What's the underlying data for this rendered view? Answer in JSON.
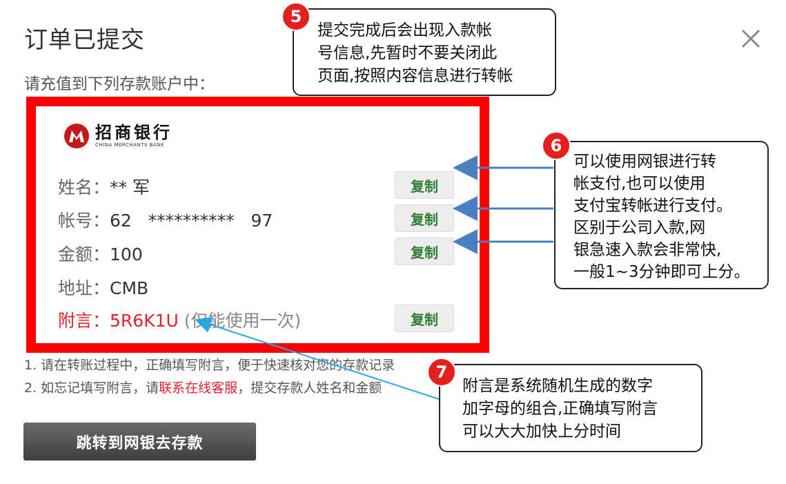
{
  "dialog": {
    "title": "订单已提交",
    "subtitle": "请充值到下列存款账户中：",
    "close_symbol": "×"
  },
  "bank": {
    "name_cn": "招商银行",
    "name_en": "CHINA MERCHANTS BANK",
    "brand_color": "#c8161d"
  },
  "fields": {
    "name": {
      "label": "姓名：",
      "value": "** 军"
    },
    "account": {
      "label": "帐号：",
      "value": "62   **********   97"
    },
    "amount": {
      "label": "金额：",
      "value": "100"
    },
    "address": {
      "label": "地址：",
      "value": "CMB"
    },
    "remark": {
      "label": "附言：",
      "value": "5R6K1U",
      "note": " (仅能使用一次)"
    }
  },
  "copy_label": "复制",
  "tips": {
    "line1": "1. 请在转账过程中，正确填写附言，便于快速核对您的存款记录",
    "line2_pre": "2. 如忘记填写附言，请",
    "line2_link": "联系在线客服",
    "line2_post": "，提交存款人姓名和金额"
  },
  "jump_button": "跳转到网银去存款",
  "callouts": {
    "c5": {
      "badge": "5",
      "lines": [
        "提交完成后会出现入款帐",
        "号信息,先暂时不要关闭此",
        "页面,按照内容信息进行转帐"
      ]
    },
    "c6": {
      "badge": "6",
      "lines": [
        "可以使用网银进行转",
        "帐支付,也可以使用",
        "支付宝转帐进行支付。",
        "区别于公司入款,网",
        "银急速入款会非常快,",
        "一般1~3分钟即可上分。"
      ]
    },
    "c7": {
      "badge": "7",
      "lines": [
        "附言是系统随机生成的数字",
        "加字母的组合,正确填写附言",
        "可以大大加快上分时间"
      ]
    }
  },
  "colors": {
    "highlight_border": "#ff0000",
    "remark_red": "#e8212e",
    "copy_green": "#2e7d32",
    "arrow_blue": "#4a7fc1",
    "badge_red": "#e61e1e"
  }
}
